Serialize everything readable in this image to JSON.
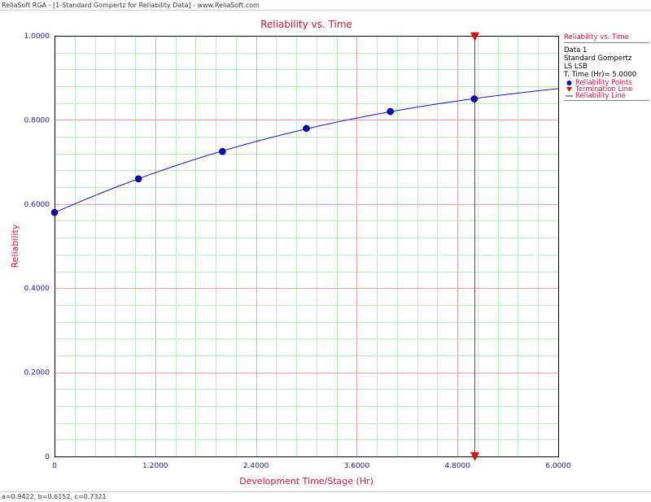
{
  "window": {
    "title": "ReliaSoft RGA - [1-Standard Gompertz for Reliability Data] - www.ReliaSoft.com"
  },
  "status_bar": {
    "text": "a=0.9422, b=0.6152, c=0.7321"
  },
  "colors": {
    "title": "#e0103a",
    "axis_label": "#e0103a",
    "tick_label": "#1a1a8c",
    "curve": "#1010d0",
    "points": "#0a0ab0",
    "termination": "#e01010",
    "major_grid": "#f2a0a0",
    "minor_grid": "#b8f0b8"
  },
  "legend": {
    "title": "Reliability vs. Time",
    "info": [
      "Data 1",
      "Standard Gompertz",
      "LS LSB",
      "T. Time (Hr)= 5.0000"
    ],
    "entries": [
      {
        "label": "Reliability Points",
        "symbol": "circle-icon"
      },
      {
        "label": "Termination Line",
        "symbol": "triangle-down-icon"
      },
      {
        "label": "Reliability Line",
        "symbol": "line-icon"
      }
    ]
  },
  "chart_data": {
    "type": "scatter",
    "title": "Reliability vs. Time",
    "xlabel": "Development Time/Stage (Hr)",
    "ylabel": "Reliability",
    "xlim": [
      0,
      6
    ],
    "ylim": [
      0,
      1
    ],
    "x_ticks": [
      "0",
      "1.2000",
      "2.4000",
      "3.6000",
      "4.8000",
      "6.0000"
    ],
    "x_tick_values": [
      0,
      1.2,
      2.4,
      3.6,
      4.8,
      6.0
    ],
    "y_ticks": [
      "0",
      "0.2000",
      "0.4000",
      "0.6000",
      "0.8000",
      "1.0000"
    ],
    "y_tick_values": [
      0,
      0.2,
      0.4,
      0.6,
      0.8,
      1.0
    ],
    "grid": true,
    "series": [
      {
        "name": "Reliability Points",
        "kind": "points",
        "x": [
          0,
          1,
          2,
          3,
          4,
          5
        ],
        "y": [
          0.58,
          0.66,
          0.725,
          0.78,
          0.82,
          0.85
        ]
      },
      {
        "name": "Reliability Line",
        "kind": "curve",
        "model": "Standard Gompertz",
        "params": {
          "a": 0.9422,
          "b": 0.6152,
          "c": 0.7321
        }
      }
    ],
    "termination_line": {
      "name": "Termination Line",
      "x": 5.0
    }
  }
}
